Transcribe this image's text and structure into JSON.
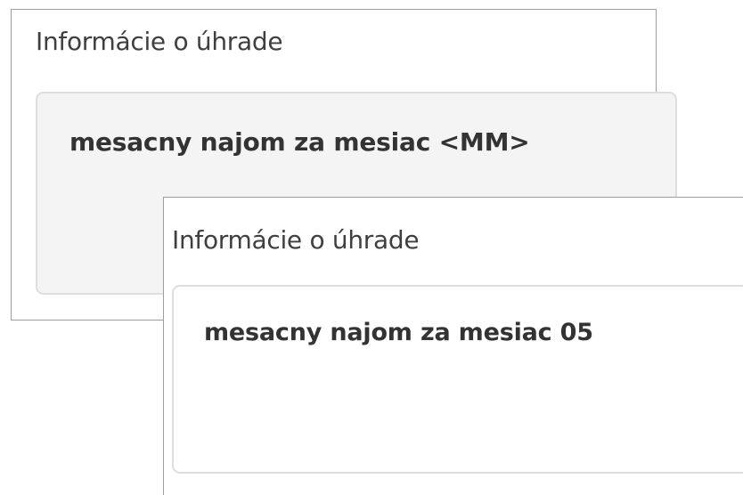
{
  "panels": [
    {
      "title": "Informácie o úhrade",
      "field_value": "mesacny najom za mesiac <MM>"
    },
    {
      "title": "Informácie o úhrade",
      "field_value": "mesacny najom za mesiac 05"
    }
  ],
  "colors": {
    "panel_border": "#9e9e9e",
    "field_border": "#dedede",
    "field_background_template": "#f4f4f4",
    "field_background_filled": "#ffffff",
    "title_text": "#3f3f3f",
    "value_text": "#333333"
  }
}
